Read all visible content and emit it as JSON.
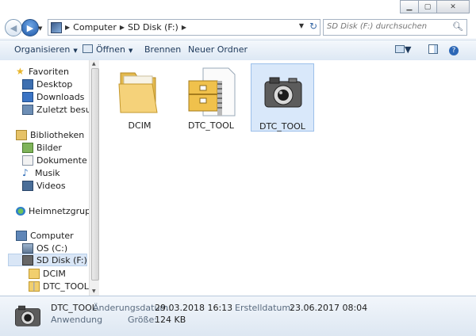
{
  "window": {
    "controls": [
      "minimize",
      "maximize",
      "close"
    ]
  },
  "address": {
    "crumbs": [
      "Computer",
      "SD Disk (F:)"
    ],
    "search_placeholder": "SD Disk (F:) durchsuchen"
  },
  "toolbar": {
    "organize_label": "Organisieren",
    "open_label": "Öffnen",
    "burn_label": "Brennen",
    "new_folder_label": "Neuer Ordner"
  },
  "sidebar": {
    "favorites": {
      "label": "Favoriten",
      "items": [
        "Desktop",
        "Downloads",
        "Zuletzt besucht"
      ]
    },
    "libraries": {
      "label": "Bibliotheken",
      "items": [
        "Bilder",
        "Dokumente",
        "Musik",
        "Videos"
      ]
    },
    "homegroup": "Heimnetzgruppe",
    "computer": {
      "label": "Computer",
      "drives": [
        "OS (C:)",
        "SD Disk (F:)"
      ],
      "subitems": [
        "DCIM",
        "DTC_TOOL"
      ]
    }
  },
  "files": [
    {
      "name": "DCIM",
      "icon": "folder-icon",
      "selected": false
    },
    {
      "name": "DTC_TOOL",
      "icon": "zip-archive-icon",
      "selected": false
    },
    {
      "name": "DTC_TOOL",
      "icon": "camera-app-icon",
      "selected": true
    }
  ],
  "details": {
    "name": "DTC_TOOL",
    "type": "Anwendung",
    "modified_label": "Änderungsdatum:",
    "modified_value": "29.03.2018 16:13",
    "created_label": "Erstelldatum:",
    "created_value": "23.06.2017 08:04",
    "size_label": "Größe:",
    "size_value": "124 KB"
  },
  "colors": {
    "accent": "#1e395b",
    "selection": "#d9e8fa"
  }
}
